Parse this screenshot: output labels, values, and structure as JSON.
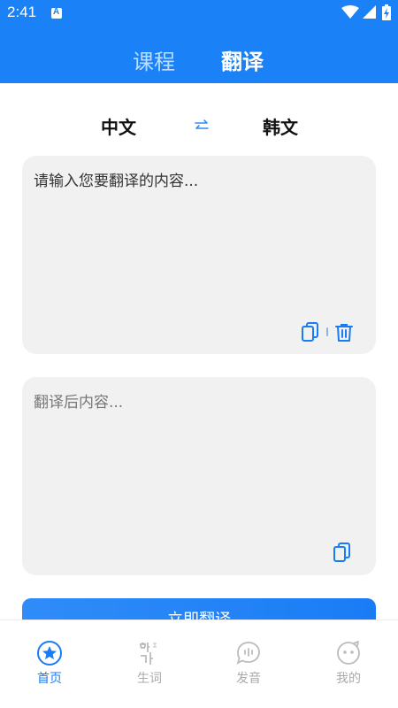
{
  "status_bar": {
    "time": "2:41",
    "icons": [
      "notification-a-icon",
      "wifi-icon",
      "signal-icon",
      "battery-charging-icon"
    ]
  },
  "header": {
    "tabs": [
      {
        "label": "课程",
        "active": false
      },
      {
        "label": "翻译",
        "active": true
      }
    ],
    "background_color": "#1a82f6"
  },
  "languages": {
    "source": "中文",
    "target": "韩文",
    "swap_icon": "swap-arrows-icon"
  },
  "input": {
    "placeholder": "请输入您要翻译的内容...",
    "icons": [
      "copy-icon",
      "delete-icon"
    ]
  },
  "output": {
    "placeholder": "翻译后内容...",
    "icons": [
      "copy-icon"
    ]
  },
  "translate_button": {
    "label": "立即翻译"
  },
  "bottom_nav": {
    "items": [
      {
        "label": "首页",
        "icon": "star-circle-icon",
        "active": true
      },
      {
        "label": "生词",
        "icon": "korean-word-icon",
        "active": false
      },
      {
        "label": "发音",
        "icon": "speech-bubble-icon",
        "active": false
      },
      {
        "label": "我的",
        "icon": "face-icon",
        "active": false
      }
    ],
    "active_color": "#1a7cf5",
    "inactive_color": "#aaaaaa"
  }
}
